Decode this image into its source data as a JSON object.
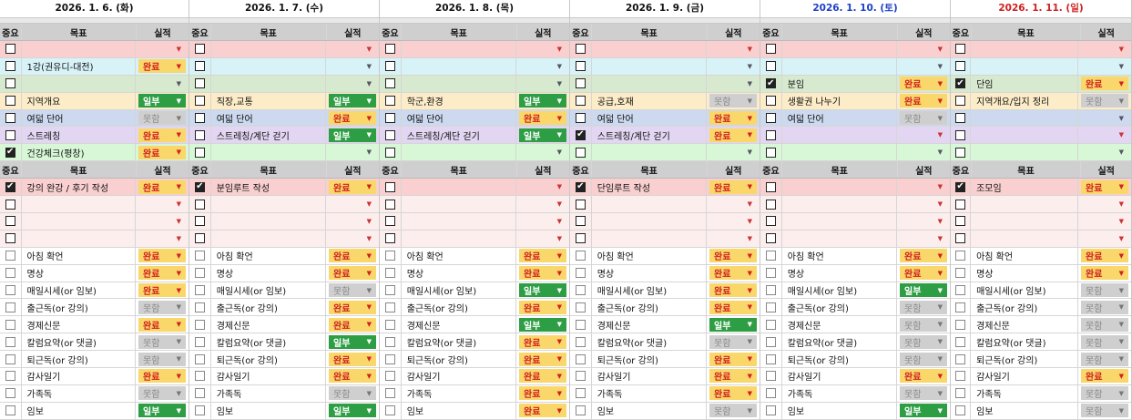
{
  "colors": {
    "saturday": "#1e40c8",
    "sunday": "#d02020",
    "weekday": "#111111",
    "done_bg": "#f9d76a",
    "partial_bg": "#2e9e45",
    "failed_bg": "#cfcfcf"
  },
  "headers": {
    "importance": "중요",
    "goal": "목표",
    "result": "실적"
  },
  "status_labels": {
    "done": "완료",
    "partial": "일부",
    "failed": "못함",
    "empty": ""
  },
  "top_row_colors": [
    "pink",
    "cyan",
    "green",
    "yellow",
    "blue",
    "purple",
    "mint"
  ],
  "mid_row_colors": [
    "pink",
    "lpink",
    "lpink",
    "lpink"
  ],
  "days": [
    {
      "date": "2026. 1. 6. (화)",
      "color": "weekday",
      "top": [
        [
          "",
          false,
          "empty"
        ],
        [
          "1강(권유디-대전)",
          false,
          "done"
        ],
        [
          "",
          false,
          "empty"
        ],
        [
          "지역개요",
          false,
          "partial"
        ],
        [
          "여덟 단어",
          false,
          "failed"
        ],
        [
          "스트레칭",
          false,
          "done"
        ],
        [
          "건강체크(평창)",
          true,
          "done"
        ]
      ],
      "mid": [
        [
          "강의 완강 / 후기 작성",
          true,
          "done"
        ],
        [
          "",
          false,
          "empty"
        ],
        [
          "",
          false,
          "empty"
        ],
        [
          "",
          false,
          "empty"
        ]
      ],
      "daily": [
        [
          "아침 확언",
          "done"
        ],
        [
          "명상",
          "done"
        ],
        [
          "매일시세(or 임보)",
          "done"
        ],
        [
          "출근독(or 강의)",
          "failed"
        ],
        [
          "경제신문",
          "done"
        ],
        [
          "칼럼요약(or 댓글)",
          "failed"
        ],
        [
          "퇴근독(or 강의)",
          "failed"
        ],
        [
          "감사일기",
          "done"
        ],
        [
          "가족독",
          "failed"
        ],
        [
          "임보",
          "partial"
        ]
      ]
    },
    {
      "date": "2026. 1. 7. (수)",
      "color": "weekday",
      "top": [
        [
          "",
          false,
          "empty"
        ],
        [
          "",
          false,
          "empty"
        ],
        [
          "",
          false,
          "empty"
        ],
        [
          "직장,교통",
          false,
          "partial"
        ],
        [
          "여덟 단어",
          false,
          "done"
        ],
        [
          "스트레칭/계단 걷기",
          false,
          "partial"
        ],
        [
          "",
          false,
          "empty"
        ]
      ],
      "mid": [
        [
          "분임루트 작성",
          true,
          "done"
        ],
        [
          "",
          false,
          "empty"
        ],
        [
          "",
          false,
          "empty"
        ],
        [
          "",
          false,
          "empty"
        ]
      ],
      "daily": [
        [
          "아침 확언",
          "done"
        ],
        [
          "명상",
          "done"
        ],
        [
          "매일시세(or 임보)",
          "failed"
        ],
        [
          "출근독(or 강의)",
          "done"
        ],
        [
          "경제신문",
          "done"
        ],
        [
          "칼럼요약(or 댓글)",
          "partial"
        ],
        [
          "퇴근독(or 강의)",
          "done"
        ],
        [
          "감사일기",
          "done"
        ],
        [
          "가족독",
          "failed"
        ],
        [
          "임보",
          "partial"
        ]
      ]
    },
    {
      "date": "2026. 1. 8. (목)",
      "color": "weekday",
      "top": [
        [
          "",
          false,
          "empty"
        ],
        [
          "",
          false,
          "empty"
        ],
        [
          "",
          false,
          "empty"
        ],
        [
          "학군,환경",
          false,
          "partial"
        ],
        [
          "여덟 단어",
          false,
          "done"
        ],
        [
          "스트레칭/계단 걷기",
          false,
          "partial"
        ],
        [
          "",
          false,
          "empty"
        ]
      ],
      "mid": [
        [
          "",
          false,
          "empty"
        ],
        [
          "",
          false,
          "empty"
        ],
        [
          "",
          false,
          "empty"
        ],
        [
          "",
          false,
          "empty"
        ]
      ],
      "daily": [
        [
          "아침 확언",
          "done"
        ],
        [
          "명상",
          "done"
        ],
        [
          "매일시세(or 임보)",
          "partial"
        ],
        [
          "출근독(or 강의)",
          "done"
        ],
        [
          "경제신문",
          "partial"
        ],
        [
          "칼럼요약(or 댓글)",
          "done"
        ],
        [
          "퇴근독(or 강의)",
          "done"
        ],
        [
          "감사일기",
          "done"
        ],
        [
          "가족독",
          "done"
        ],
        [
          "임보",
          "done"
        ]
      ]
    },
    {
      "date": "2026. 1. 9. (금)",
      "color": "weekday",
      "top": [
        [
          "",
          false,
          "empty"
        ],
        [
          "",
          false,
          "empty"
        ],
        [
          "",
          false,
          "empty"
        ],
        [
          "공급,호재",
          false,
          "failed"
        ],
        [
          "여덟 단어",
          false,
          "done"
        ],
        [
          "스트레칭/계단 걷기",
          true,
          "done"
        ],
        [
          "",
          false,
          "empty"
        ]
      ],
      "mid": [
        [
          "단임루트 작성",
          true,
          "done"
        ],
        [
          "",
          false,
          "empty"
        ],
        [
          "",
          false,
          "empty"
        ],
        [
          "",
          false,
          "empty"
        ]
      ],
      "daily": [
        [
          "아침 확언",
          "done"
        ],
        [
          "명상",
          "done"
        ],
        [
          "매일시세(or 임보)",
          "done"
        ],
        [
          "출근독(or 강의)",
          "done"
        ],
        [
          "경제신문",
          "partial"
        ],
        [
          "칼럼요약(or 댓글)",
          "failed"
        ],
        [
          "퇴근독(or 강의)",
          "done"
        ],
        [
          "감사일기",
          "done"
        ],
        [
          "가족독",
          "done"
        ],
        [
          "임보",
          "failed"
        ]
      ]
    },
    {
      "date": "2026. 1. 10. (토)",
      "color": "saturday",
      "top": [
        [
          "",
          false,
          "empty"
        ],
        [
          "",
          false,
          "empty"
        ],
        [
          "분임",
          true,
          "done"
        ],
        [
          "생활권 나누기",
          false,
          "done"
        ],
        [
          "여덟 단어",
          false,
          "failed"
        ],
        [
          "",
          false,
          "empty"
        ],
        [
          "",
          false,
          "empty"
        ]
      ],
      "mid": [
        [
          "",
          false,
          "empty"
        ],
        [
          "",
          false,
          "empty"
        ],
        [
          "",
          false,
          "empty"
        ],
        [
          "",
          false,
          "empty"
        ]
      ],
      "daily": [
        [
          "아침 확언",
          "done"
        ],
        [
          "명상",
          "done"
        ],
        [
          "매일시세(or 임보)",
          "partial"
        ],
        [
          "출근독(or 강의)",
          "failed"
        ],
        [
          "경제신문",
          "failed"
        ],
        [
          "칼럼요약(or 댓글)",
          "failed"
        ],
        [
          "퇴근독(or 강의)",
          "failed"
        ],
        [
          "감사일기",
          "done"
        ],
        [
          "가족독",
          "failed"
        ],
        [
          "임보",
          "partial"
        ]
      ]
    },
    {
      "date": "2026. 1. 11. (일)",
      "color": "sunday",
      "top": [
        [
          "",
          false,
          "empty"
        ],
        [
          "",
          false,
          "empty"
        ],
        [
          "단임",
          true,
          "done"
        ],
        [
          "지역개요/입지 정리",
          false,
          "failed"
        ],
        [
          "",
          false,
          "empty"
        ],
        [
          "",
          false,
          "empty"
        ],
        [
          "",
          false,
          "empty"
        ]
      ],
      "mid": [
        [
          "조모임",
          true,
          "done"
        ],
        [
          "",
          false,
          "empty"
        ],
        [
          "",
          false,
          "empty"
        ],
        [
          "",
          false,
          "empty"
        ]
      ],
      "daily": [
        [
          "아침 확언",
          "done"
        ],
        [
          "명상",
          "done"
        ],
        [
          "매일시세(or 임보)",
          "failed"
        ],
        [
          "출근독(or 강의)",
          "failed"
        ],
        [
          "경제신문",
          "failed"
        ],
        [
          "칼럼요약(or 댓글)",
          "failed"
        ],
        [
          "퇴근독(or 강의)",
          "failed"
        ],
        [
          "감사일기",
          "done"
        ],
        [
          "가족독",
          "failed"
        ],
        [
          "임보",
          "failed"
        ]
      ]
    }
  ]
}
